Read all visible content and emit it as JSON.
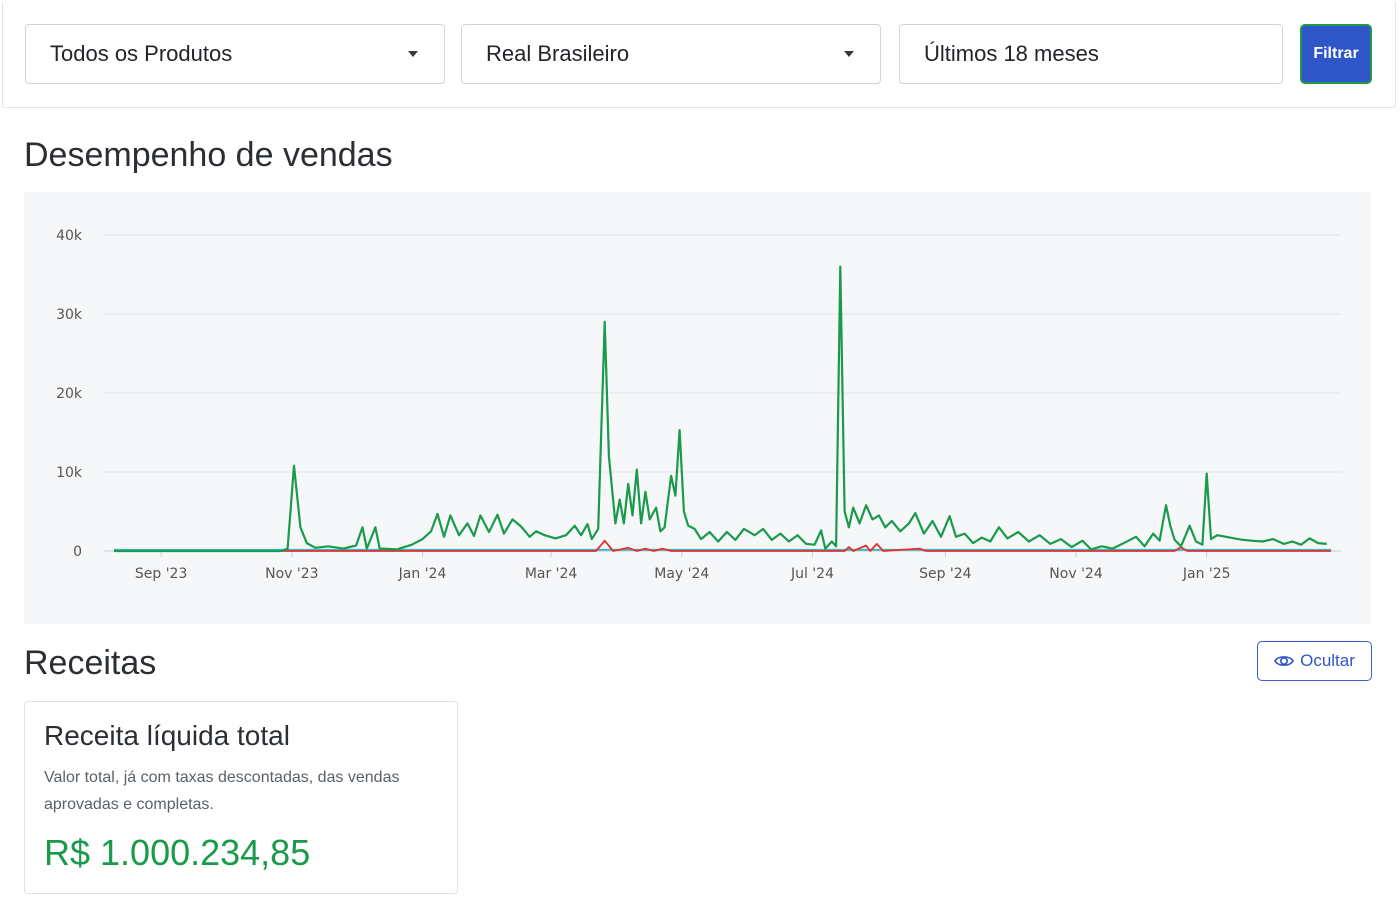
{
  "filters": {
    "product_select": "Todos os Produtos",
    "currency_select": "Real Brasileiro",
    "period_value": "Últimos 18 meses",
    "filter_button": "Filtrar"
  },
  "sales_section": {
    "title": "Desempenho de vendas"
  },
  "revenue_section": {
    "title": "Receitas",
    "hide_button": "Ocultar",
    "card": {
      "title": "Receita líquida total",
      "description": "Valor total, já com taxas descontadas, das vendas aprovadas e completas.",
      "value": "R$ 1.000.234,85"
    }
  },
  "colors": {
    "primary": "#2f56c8",
    "success": "#1a9a4b",
    "refund": "#e03131",
    "secondary_line": "#3bb5c5"
  },
  "icons": {
    "hide_button": "eye-icon",
    "select_caret": "caret-down-icon"
  },
  "chart_data": {
    "type": "line",
    "title": "",
    "xlabel": "",
    "ylabel": "",
    "ylim": [
      0,
      40000
    ],
    "yticks": [
      0,
      10000,
      20000,
      30000,
      40000
    ],
    "ytick_labels": [
      "0",
      "10k",
      "20k",
      "30k",
      "40k"
    ],
    "xtick_labels": [
      "Sep '23",
      "Nov '23",
      "Jan '24",
      "Mar '24",
      "May '24",
      "Jul '24",
      "Sep '24",
      "Nov '24",
      "Jan '25"
    ],
    "xtick_dates": [
      "2023-09-01",
      "2023-11-01",
      "2024-01-01",
      "2024-03-01",
      "2024-05-01",
      "2024-07-01",
      "2024-09-01",
      "2024-11-01",
      "2025-01-01"
    ],
    "x_range": [
      "2023-08-10",
      "2025-02-28"
    ],
    "grid": true,
    "series": [
      {
        "color": "#1a9a4b",
        "points": [
          [
            "2023-08-10",
            0
          ],
          [
            "2023-10-27",
            0
          ],
          [
            "2023-10-30",
            300
          ],
          [
            "2023-11-02",
            10800
          ],
          [
            "2023-11-05",
            3000
          ],
          [
            "2023-11-08",
            1000
          ],
          [
            "2023-11-12",
            400
          ],
          [
            "2023-11-18",
            600
          ],
          [
            "2023-11-25",
            300
          ],
          [
            "2023-12-01",
            700
          ],
          [
            "2023-12-04",
            3000
          ],
          [
            "2023-12-06",
            300
          ],
          [
            "2023-12-10",
            3000
          ],
          [
            "2023-12-12",
            300
          ],
          [
            "2023-12-20",
            200
          ],
          [
            "2023-12-27",
            800
          ],
          [
            "2024-01-01",
            1500
          ],
          [
            "2024-01-05",
            2500
          ],
          [
            "2024-01-08",
            4700
          ],
          [
            "2024-01-11",
            1800
          ],
          [
            "2024-01-14",
            4500
          ],
          [
            "2024-01-18",
            2000
          ],
          [
            "2024-01-22",
            3500
          ],
          [
            "2024-01-25",
            1900
          ],
          [
            "2024-01-28",
            4500
          ],
          [
            "2024-02-01",
            2400
          ],
          [
            "2024-02-05",
            4600
          ],
          [
            "2024-02-08",
            2200
          ],
          [
            "2024-02-12",
            4000
          ],
          [
            "2024-02-16",
            3100
          ],
          [
            "2024-02-20",
            1800
          ],
          [
            "2024-02-23",
            2500
          ],
          [
            "2024-02-27",
            2000
          ],
          [
            "2024-03-03",
            1600
          ],
          [
            "2024-03-08",
            2000
          ],
          [
            "2024-03-12",
            3200
          ],
          [
            "2024-03-15",
            2000
          ],
          [
            "2024-03-18",
            3400
          ],
          [
            "2024-03-20",
            1500
          ],
          [
            "2024-03-23",
            2800
          ],
          [
            "2024-03-26",
            29000
          ],
          [
            "2024-03-28",
            12000
          ],
          [
            "2024-03-31",
            3500
          ],
          [
            "2024-04-02",
            6500
          ],
          [
            "2024-04-04",
            3500
          ],
          [
            "2024-04-06",
            8500
          ],
          [
            "2024-04-08",
            4500
          ],
          [
            "2024-04-10",
            10300
          ],
          [
            "2024-04-12",
            3500
          ],
          [
            "2024-04-14",
            7500
          ],
          [
            "2024-04-16",
            4000
          ],
          [
            "2024-04-19",
            5500
          ],
          [
            "2024-04-21",
            2500
          ],
          [
            "2024-04-23",
            3000
          ],
          [
            "2024-04-26",
            9500
          ],
          [
            "2024-04-28",
            7000
          ],
          [
            "2024-04-30",
            15300
          ],
          [
            "2024-05-02",
            5000
          ],
          [
            "2024-05-04",
            3200
          ],
          [
            "2024-05-07",
            2800
          ],
          [
            "2024-05-10",
            1500
          ],
          [
            "2024-05-14",
            2400
          ],
          [
            "2024-05-18",
            1200
          ],
          [
            "2024-05-22",
            2400
          ],
          [
            "2024-05-26",
            1400
          ],
          [
            "2024-05-30",
            2800
          ],
          [
            "2024-06-04",
            2000
          ],
          [
            "2024-06-08",
            2800
          ],
          [
            "2024-06-12",
            1400
          ],
          [
            "2024-06-16",
            2200
          ],
          [
            "2024-06-20",
            1200
          ],
          [
            "2024-06-24",
            2000
          ],
          [
            "2024-06-28",
            900
          ],
          [
            "2024-07-02",
            800
          ],
          [
            "2024-07-05",
            2600
          ],
          [
            "2024-07-07",
            300
          ],
          [
            "2024-07-10",
            1200
          ],
          [
            "2024-07-12",
            600
          ],
          [
            "2024-07-14",
            36000
          ],
          [
            "2024-07-16",
            5000
          ],
          [
            "2024-07-18",
            3000
          ],
          [
            "2024-07-20",
            5500
          ],
          [
            "2024-07-23",
            3500
          ],
          [
            "2024-07-26",
            5800
          ],
          [
            "2024-07-29",
            4000
          ],
          [
            "2024-08-01",
            4500
          ],
          [
            "2024-08-04",
            3000
          ],
          [
            "2024-08-07",
            3800
          ],
          [
            "2024-08-11",
            2500
          ],
          [
            "2024-08-15",
            3500
          ],
          [
            "2024-08-18",
            4800
          ],
          [
            "2024-08-22",
            2200
          ],
          [
            "2024-08-26",
            3800
          ],
          [
            "2024-08-30",
            1800
          ],
          [
            "2024-09-03",
            4400
          ],
          [
            "2024-09-06",
            1800
          ],
          [
            "2024-09-10",
            2200
          ],
          [
            "2024-09-14",
            1000
          ],
          [
            "2024-09-18",
            1700
          ],
          [
            "2024-09-22",
            1200
          ],
          [
            "2024-09-26",
            3000
          ],
          [
            "2024-09-30",
            1600
          ],
          [
            "2024-10-05",
            2400
          ],
          [
            "2024-10-10",
            1200
          ],
          [
            "2024-10-15",
            2000
          ],
          [
            "2024-10-20",
            900
          ],
          [
            "2024-10-25",
            1500
          ],
          [
            "2024-10-30",
            500
          ],
          [
            "2024-11-04",
            1300
          ],
          [
            "2024-11-08",
            200
          ],
          [
            "2024-11-13",
            600
          ],
          [
            "2024-11-18",
            300
          ],
          [
            "2024-11-24",
            1100
          ],
          [
            "2024-11-29",
            1800
          ],
          [
            "2024-12-03",
            600
          ],
          [
            "2024-12-07",
            2200
          ],
          [
            "2024-12-10",
            1300
          ],
          [
            "2024-12-13",
            5800
          ],
          [
            "2024-12-15",
            3200
          ],
          [
            "2024-12-17",
            1400
          ],
          [
            "2024-12-20",
            600
          ],
          [
            "2024-12-24",
            3200
          ],
          [
            "2024-12-27",
            1200
          ],
          [
            "2024-12-30",
            800
          ],
          [
            "2025-01-01",
            9800
          ],
          [
            "2025-01-03",
            1500
          ],
          [
            "2025-01-06",
            2000
          ],
          [
            "2025-01-10",
            1800
          ],
          [
            "2025-01-14",
            1600
          ],
          [
            "2025-01-18",
            1400
          ],
          [
            "2025-01-22",
            1300
          ],
          [
            "2025-01-27",
            1200
          ],
          [
            "2025-02-01",
            1500
          ],
          [
            "2025-02-06",
            900
          ],
          [
            "2025-02-10",
            1200
          ],
          [
            "2025-02-14",
            800
          ],
          [
            "2025-02-18",
            1600
          ],
          [
            "2025-02-22",
            1000
          ],
          [
            "2025-02-26",
            900
          ]
        ]
      },
      {
        "color": "#e03131",
        "points": [
          [
            "2023-08-10",
            0
          ],
          [
            "2024-03-22",
            0
          ],
          [
            "2024-03-26",
            1300
          ],
          [
            "2024-03-30",
            0
          ],
          [
            "2024-04-06",
            400
          ],
          [
            "2024-04-10",
            0
          ],
          [
            "2024-04-14",
            300
          ],
          [
            "2024-04-18",
            0
          ],
          [
            "2024-04-22",
            300
          ],
          [
            "2024-04-26",
            0
          ],
          [
            "2024-07-16",
            0
          ],
          [
            "2024-07-18",
            500
          ],
          [
            "2024-07-20",
            0
          ],
          [
            "2024-07-26",
            700
          ],
          [
            "2024-07-28",
            0
          ],
          [
            "2024-07-31",
            900
          ],
          [
            "2024-08-03",
            0
          ],
          [
            "2024-08-20",
            300
          ],
          [
            "2024-08-23",
            0
          ],
          [
            "2024-12-17",
            0
          ],
          [
            "2024-12-20",
            500
          ],
          [
            "2024-12-23",
            0
          ],
          [
            "2025-02-28",
            0
          ]
        ]
      },
      {
        "color": "#3bb5c5",
        "points": [
          [
            "2023-08-10",
            150
          ],
          [
            "2025-02-28",
            150
          ]
        ]
      }
    ]
  }
}
